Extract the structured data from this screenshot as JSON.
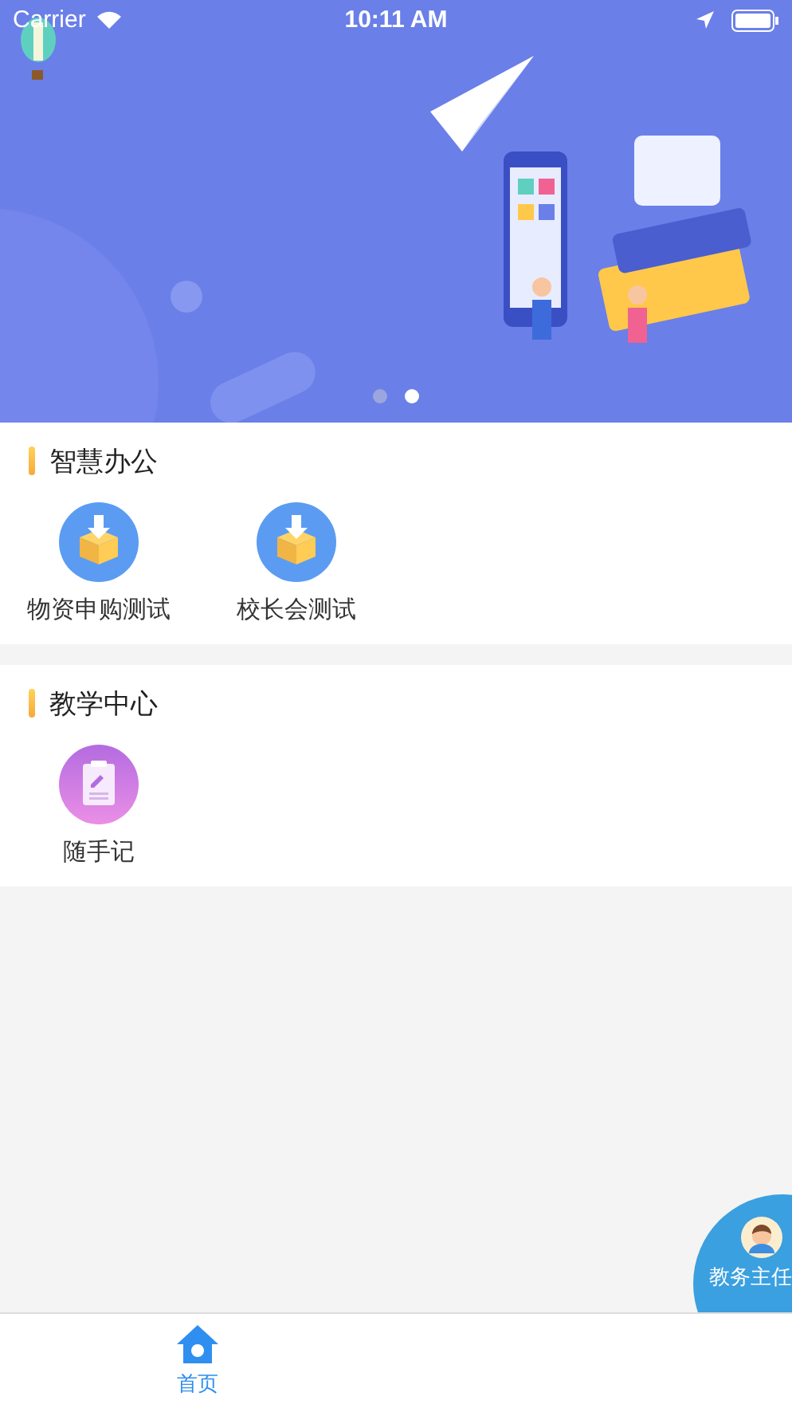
{
  "status_bar": {
    "carrier": "Carrier",
    "time": "10:11 AM"
  },
  "banner": {
    "pages": [
      {
        "selected": false
      },
      {
        "selected": true
      }
    ]
  },
  "sections": [
    {
      "title": "智慧办公",
      "items": [
        {
          "label": "物资申购测试",
          "kind": "box"
        },
        {
          "label": "校长会测试",
          "kind": "box"
        }
      ]
    },
    {
      "title": "教学中心",
      "items": [
        {
          "label": "随手记",
          "kind": "note"
        }
      ]
    }
  ],
  "floating_button": {
    "label": "教务主任"
  },
  "tabs": [
    {
      "label": "首页",
      "selected": true
    }
  ]
}
